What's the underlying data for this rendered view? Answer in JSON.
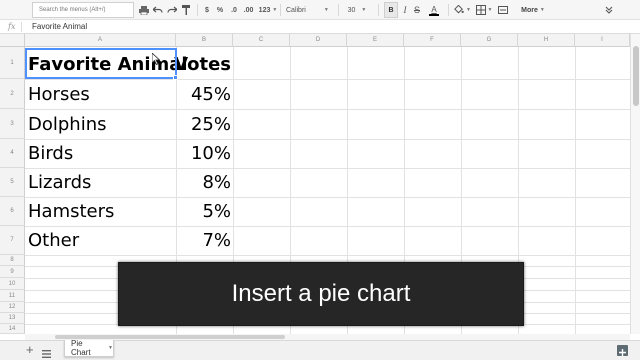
{
  "toolbar": {
    "menu_search_placeholder": "Search the menus (Alt+/)",
    "currency_label": "$",
    "percent_label": "%",
    "decimal_less_label": ".0",
    "decimal_more_label": ".00",
    "number_format_label": "123",
    "font_name": "Calibri",
    "font_size": "30",
    "bold_label": "B",
    "italic_label": "I",
    "strike_label": "S",
    "text_color_label": "A",
    "more_label": "More"
  },
  "formula_bar": {
    "fx_label": "fx",
    "content": "Favorite Animal"
  },
  "columns": [
    "A",
    "B",
    "C",
    "D",
    "E",
    "F",
    "G",
    "H",
    "I"
  ],
  "row_numbers": [
    "1",
    "2",
    "3",
    "4",
    "5",
    "6",
    "7",
    "8",
    "9",
    "10",
    "11",
    "12",
    "13",
    "14"
  ],
  "table": {
    "header": {
      "animal": "Favorite Animal",
      "votes": "Votes"
    },
    "rows": [
      {
        "animal": "Horses",
        "votes": "45%"
      },
      {
        "animal": "Dolphins",
        "votes": "25%"
      },
      {
        "animal": "Birds",
        "votes": "10%"
      },
      {
        "animal": "Lizards",
        "votes": "8%"
      },
      {
        "animal": "Hamsters",
        "votes": "5%"
      },
      {
        "animal": "Other",
        "votes": "7%"
      }
    ]
  },
  "sheet_tabs": [
    {
      "label": "Pie Chart"
    }
  ],
  "caption": "Insert a pie chart",
  "colors": {
    "selection": "#4d90fe",
    "caption_bg": "#262626"
  }
}
